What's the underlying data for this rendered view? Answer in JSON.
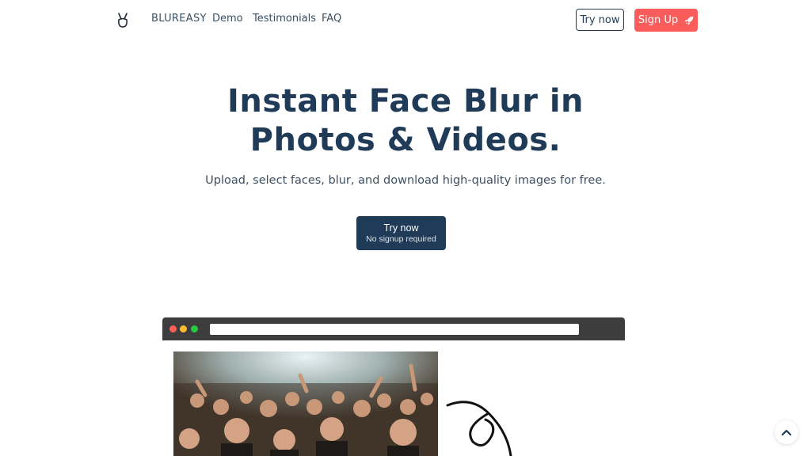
{
  "nav": {
    "brand": "BLUREASY",
    "links": [
      "Demo",
      "Testimonials",
      "FAQ"
    ],
    "try_now": "Try now",
    "sign_up": "Sign Up"
  },
  "hero": {
    "title_line1": "Instant Face Blur in",
    "title_line2": "Photos & Videos.",
    "subtitle": "Upload, select faces, blur, and download high-quality images for free.",
    "cta_main": "Try now",
    "cta_sub": "No signup required"
  },
  "colors": {
    "primary": "#1f3b57",
    "accent": "#fa5c5c",
    "background": "#ffffff"
  },
  "icons": {
    "logo": "hand-peace-logo",
    "sign_up": "rocket-icon",
    "scroll": "chevron-up-icon"
  }
}
